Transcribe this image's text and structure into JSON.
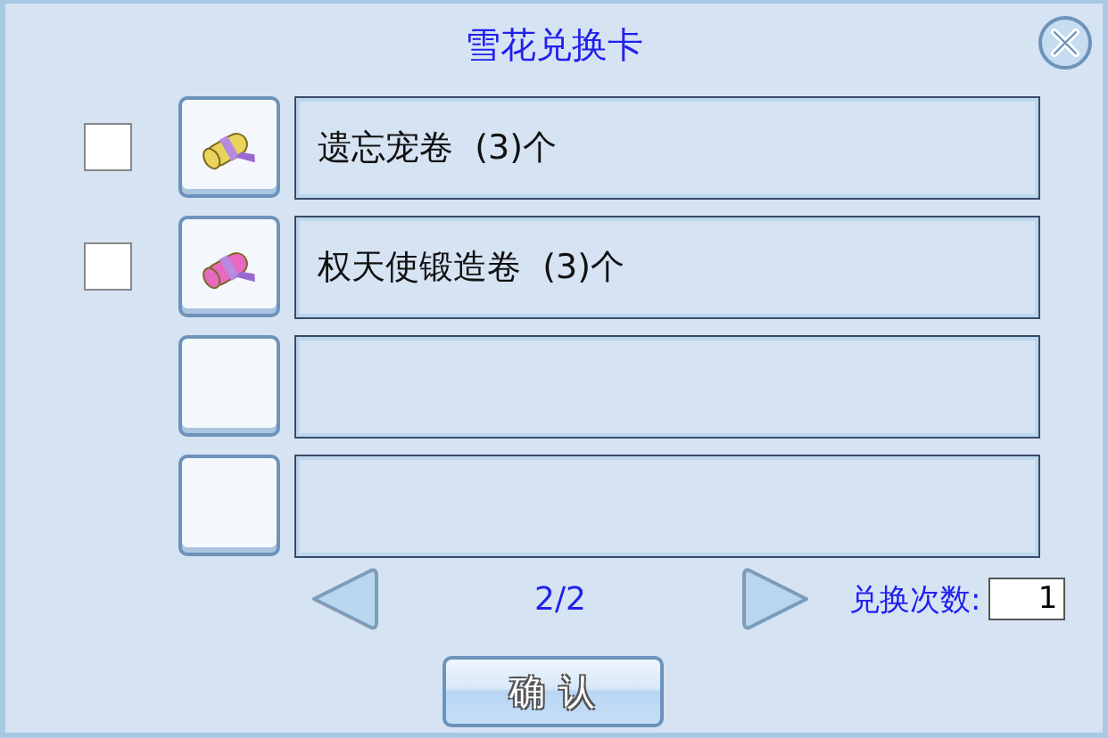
{
  "window": {
    "title": "雪花兑换卡"
  },
  "items": [
    {
      "kind": "scroll",
      "name": "遗忘宠卷  (3)个",
      "checked": false,
      "color": "#e8d45a"
    },
    {
      "kind": "scroll",
      "name": "权天使锻造卷  (3)个",
      "checked": false,
      "color": "#e86ac0"
    },
    {
      "kind": "empty"
    },
    {
      "kind": "empty"
    }
  ],
  "pager": {
    "page": "2/2"
  },
  "exchange": {
    "label": "兑换次数:",
    "value": "1"
  },
  "confirm": "确 认"
}
